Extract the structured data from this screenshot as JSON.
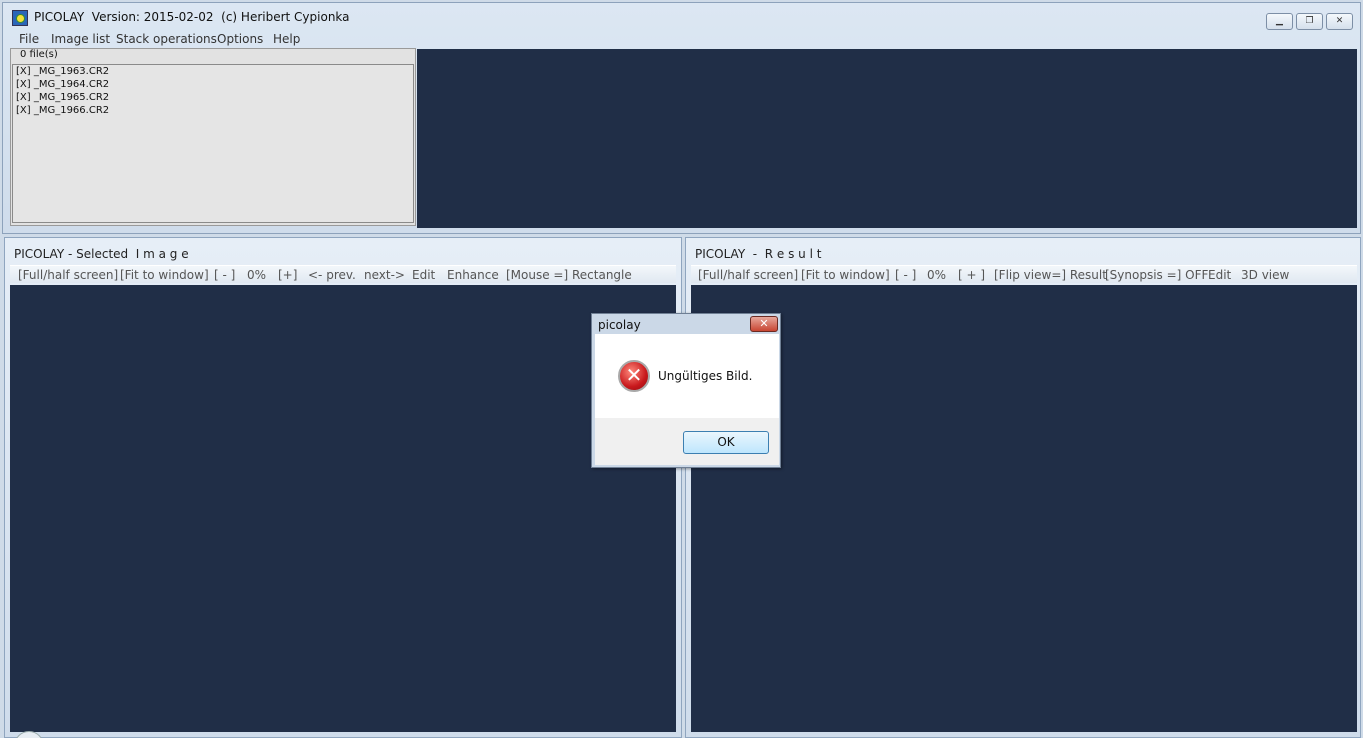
{
  "window": {
    "title": "PICOLAY  Version: 2015-02-02  (c) Heribert Cypionka",
    "icon": "picolay-app-icon",
    "controls": {
      "minimize": "minimize-icon",
      "maximize": "restore-icon",
      "close": "close-icon"
    }
  },
  "menu": {
    "items": [
      {
        "label": "File"
      },
      {
        "label": "Image list"
      },
      {
        "label": "Stack operations"
      },
      {
        "label": "Options"
      },
      {
        "label": "Help"
      }
    ]
  },
  "file_panel": {
    "count_label": "0 file(s)",
    "files": [
      "[X] _MG_1963.CR2",
      "[X] _MG_1964.CR2",
      "[X] _MG_1965.CR2",
      "[X] _MG_1966.CR2"
    ]
  },
  "left_panel": {
    "title": "PICOLAY - Selected  I m a g e",
    "toolbar": [
      "[Full/half screen]",
      "[Fit to window]",
      "[ - ]",
      "0%",
      "[+]",
      "<- prev.",
      "next->",
      "Edit",
      "Enhance",
      "[Mouse =] Rectangle"
    ]
  },
  "right_panel": {
    "title": "PICOLAY  -  R e s u l t",
    "toolbar": [
      "[Full/half screen]",
      "[Fit to window]",
      "[ - ]",
      "0%",
      "[ + ]",
      "[Flip view=] Result",
      "[Synopsis =] OFF",
      "Edit",
      "3D view"
    ]
  },
  "dialog": {
    "title": "picolay",
    "close_glyph": "✕",
    "icon": "error-icon",
    "message": "Ungültiges Bild.",
    "ok_label": "OK"
  },
  "colors": {
    "dark_view": "#202e47",
    "frame": "#cfdbe8"
  }
}
